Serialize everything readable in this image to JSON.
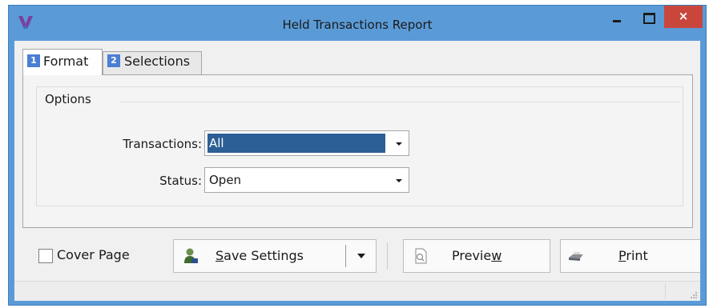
{
  "window": {
    "title": "Held Transactions Report",
    "close_glyph": "×"
  },
  "tabs": [
    {
      "number": "1",
      "label": "Format",
      "selected": true
    },
    {
      "number": "2",
      "label": "Selections",
      "selected": false
    }
  ],
  "options": {
    "group_label": "Options",
    "transactions": {
      "label": "Transactions:",
      "value": "All"
    },
    "status": {
      "label": "Status:",
      "value": "Open"
    }
  },
  "footer": {
    "cover_page_label": "Cover Page",
    "cover_page_checked": false,
    "save_settings": {
      "text_before": "",
      "access_key": "S",
      "text_after": "ave Settings"
    },
    "preview": {
      "text_before": "Previe",
      "access_key": "w",
      "text_after": ""
    },
    "print": {
      "text_before": "",
      "access_key": "P",
      "text_after": "rint"
    }
  },
  "icons": {
    "app": "app-logo-icon",
    "save": "user-save-icon",
    "preview": "document-preview-icon",
    "print": "printer-icon"
  },
  "colors": {
    "title_bar": "#5a9bd7",
    "close_button": "#c9463d",
    "selection": "#2c5f95",
    "tab_number": "#4a7fd4"
  }
}
